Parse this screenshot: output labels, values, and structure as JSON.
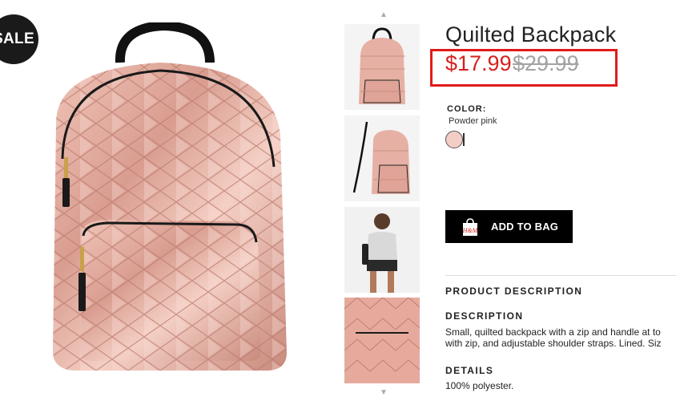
{
  "badge": {
    "sale": "SALE"
  },
  "product": {
    "title": "Quilted Backpack",
    "price_sale": "$17.99",
    "price_original": "$29.99",
    "color_label": "COLOR:",
    "color_value": "Powder pink",
    "swatch_color": "#f3cdc6"
  },
  "actions": {
    "add_to_bag": "ADD TO BAG",
    "bag_logo": "H&M"
  },
  "sections": {
    "product_description": "PRODUCT DESCRIPTION",
    "description_heading": "DESCRIPTION",
    "description_line1": "Small, quilted backpack with a zip and handle at to",
    "description_line2": "with zip, and adjustable shoulder straps. Lined. Siz",
    "details_heading": "DETAILS",
    "details_line1": "100% polyester."
  },
  "colors": {
    "accent_red": "#d6211f",
    "highlight_box": "#e01b1b"
  }
}
